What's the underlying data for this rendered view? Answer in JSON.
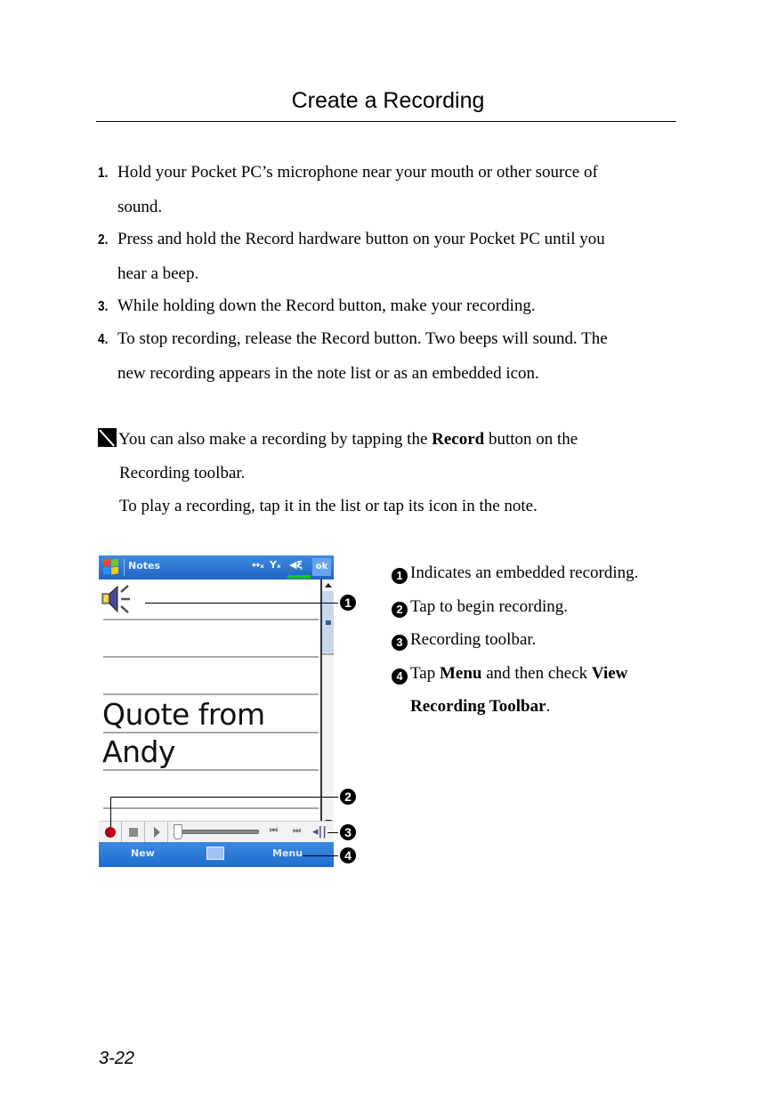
{
  "header": {
    "title": "Create a Recording"
  },
  "steps": [
    {
      "num": "1.",
      "text": "Hold your Pocket PC’s microphone near your mouth or other source of",
      "cont": "sound."
    },
    {
      "num": "2.",
      "text": "Press and hold the Record hardware button on your Pocket PC until you",
      "cont": "hear a beep."
    },
    {
      "num": "3.",
      "text": "While holding down the Record button, make your recording."
    },
    {
      "num": "4.",
      "text": "To stop recording, release the Record button. Two beeps will sound. The",
      "cont": "new recording appears in the note list or as an embedded icon."
    }
  ],
  "note": {
    "icon": "pen-note-icon",
    "line1_pre": "You can also make a recording by tapping the ",
    "line1_bold": "Record",
    "line1_post": " button on the",
    "line2": "Recording toolbar.",
    "line3": "To play a recording, tap it in the list or tap its icon in the note."
  },
  "device": {
    "app_title": "Notes",
    "ok_label": "ok",
    "tray_icons": [
      "connectivity-icon",
      "signal-icon",
      "volume-icon"
    ],
    "note_lines": [
      "Quote from",
      "Andy"
    ],
    "embedded_icon": "speaker-recording-icon",
    "toolbar": {
      "record": "record-icon",
      "stop": "stop-icon",
      "play": "play-icon",
      "skip_back": "⏮",
      "skip_fwd": "⏭",
      "volume": "volume-icon"
    },
    "menubar": {
      "new_label": "New",
      "menu_label": "Menu",
      "keyboard": "keyboard-icon"
    }
  },
  "callouts": [
    "1",
    "2",
    "3",
    "4"
  ],
  "legend": [
    {
      "badge": "1",
      "text": "Indicates an embedded recording."
    },
    {
      "badge": "2",
      "text": "Tap to begin recording."
    },
    {
      "badge": "3",
      "text": "Recording toolbar."
    },
    {
      "badge": "4",
      "pre": "Tap ",
      "bold1": "Menu",
      "mid": " and then check ",
      "bold2": "View",
      "cont_bold": "Recording Toolbar",
      "cont_post": "."
    }
  ],
  "footer": {
    "page_number": "3-22"
  }
}
